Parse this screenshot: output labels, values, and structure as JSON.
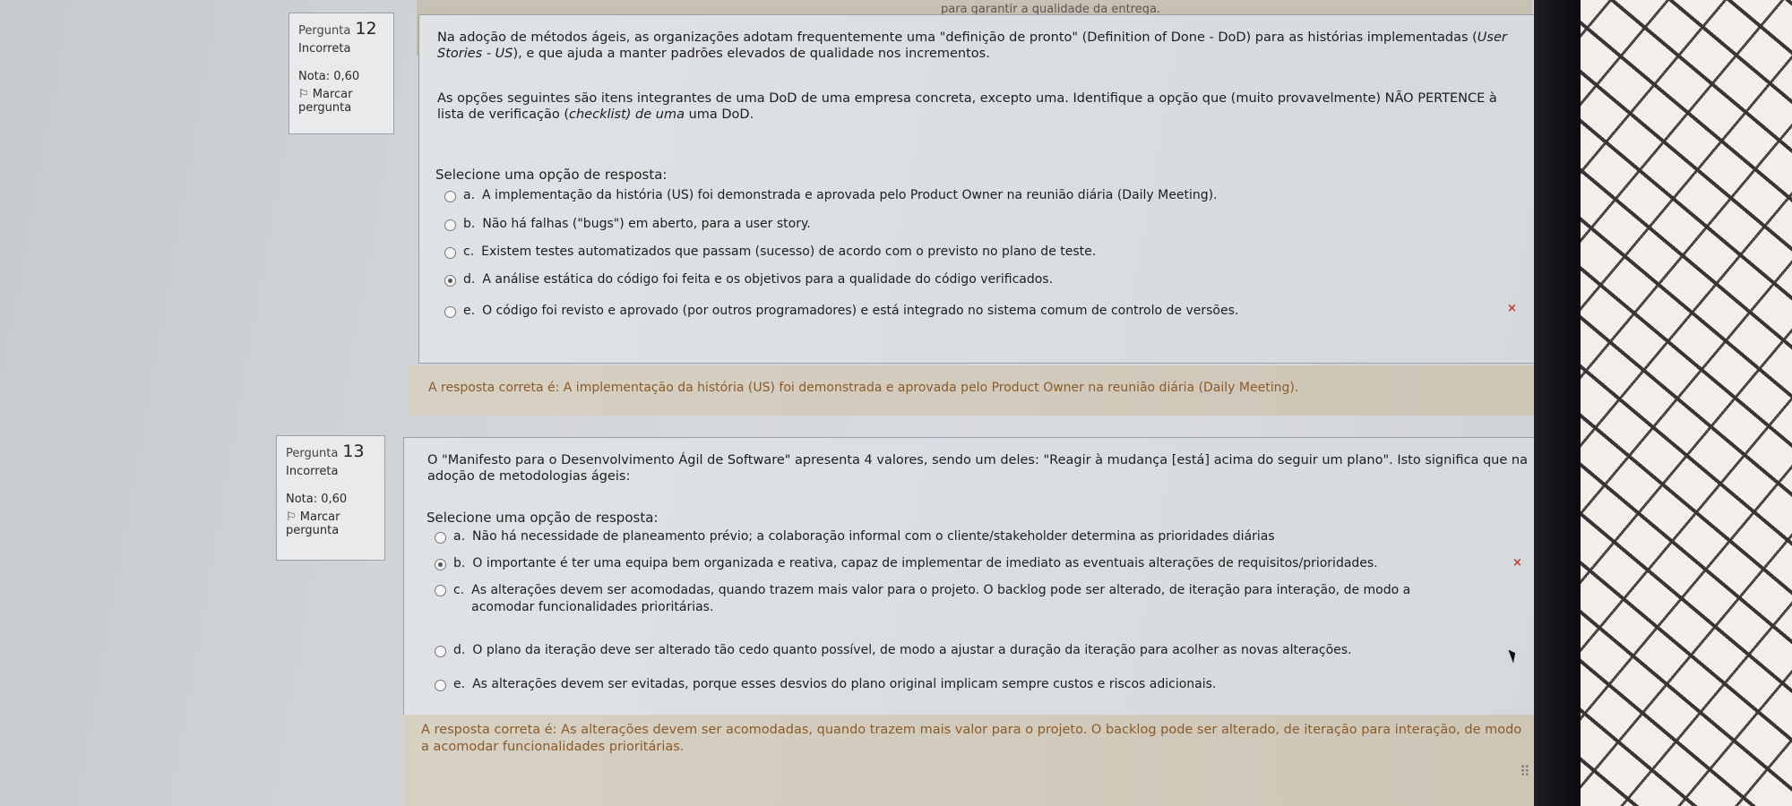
{
  "top_strip_text": "para garantir a qualidade da entrega.",
  "q12": {
    "label": "Pergunta",
    "number": "12",
    "status": "Incorreta",
    "grade": "Nota: 0,60",
    "flag_label": "Marcar pergunta",
    "text_1": "Na adoção de métodos ágeis, as organizações adotam frequentemente uma \"definição de pronto\" (Definition of Done - DoD) para as histórias implementadas (",
    "text_1_italic": "User Stories - US",
    "text_1_end": "), e que ajuda a manter padrões elevados de qualidade nos incrementos.",
    "text_2": "As opções seguintes são itens integrantes de uma DoD de uma empresa concreta, excepto uma. Identifique a opção que (muito provavelmente) NÃO PERTENCE à lista de verificação (",
    "text_2_italic": "checklist) de uma",
    "text_2_end": " uma DoD.",
    "prompt": "Selecione uma opção de resposta:",
    "options": [
      {
        "letter": "a.",
        "text": "A implementação da história (US) foi demonstrada e aprovada pelo Product Owner na reunião diária (Daily Meeting).",
        "checked": false
      },
      {
        "letter": "b.",
        "text": "Não há falhas (\"bugs\") em aberto, para a user story.",
        "checked": false
      },
      {
        "letter": "c.",
        "text": "Existem testes automatizados que passam (sucesso) de acordo com o previsto no plano de teste.",
        "checked": false
      },
      {
        "letter": "d.",
        "text": "A análise estática do código foi feita e os objetivos para a qualidade do código verificados.",
        "checked": true
      },
      {
        "letter": "e.",
        "text": "O código foi revisto e aprovado (por outros programadores) e está integrado no sistema comum de controlo de versões.",
        "checked": false
      }
    ],
    "wrong_mark": "×",
    "feedback": "A resposta correta é: A implementação da história (US) foi demonstrada e aprovada pelo Product Owner na reunião diária (Daily Meeting)."
  },
  "q13": {
    "label": "Pergunta",
    "number": "13",
    "status": "Incorreta",
    "grade": "Nota: 0,60",
    "flag_label": "Marcar pergunta",
    "text_1": "O \"Manifesto para o Desenvolvimento Ágil de Software\" apresenta 4 valores, sendo um deles: \"Reagir à mudança [está] acima do seguir um plano\". Isto significa que na adoção de metodologias ágeis:",
    "prompt": "Selecione uma opção de resposta:",
    "options": [
      {
        "letter": "a.",
        "text": "Não há necessidade de planeamento prévio;  a colaboração informal com o cliente/stakeholder determina as prioridades diárias",
        "checked": false
      },
      {
        "letter": "b.",
        "text": "O importante é ter uma equipa bem organizada e reativa, capaz de implementar de imediato as eventuais alterações de requisitos/prioridades.",
        "checked": true
      },
      {
        "letter": "c.",
        "text": "As alterações devem ser acomodadas, quando trazem mais valor para o projeto.  O backlog pode ser alterado, de iteração para interação, de modo a acomodar funcionalidades prioritárias.",
        "checked": false
      },
      {
        "letter": "d.",
        "text": "O plano da iteração deve ser alterado tão cedo quanto possível, de modo a ajustar a duração da iteração para acolher as novas alterações.",
        "checked": false
      },
      {
        "letter": "e.",
        "text": "As alterações devem ser evitadas, porque esses desvios do plano original implicam sempre custos e riscos adicionais.",
        "checked": false
      }
    ],
    "wrong_mark": "×",
    "feedback": "A resposta correta é: As alterações devem ser acomodadas, quando trazem mais valor para o projeto.  O backlog pode ser alterado, de iteração para interação, de modo a acomodar funcionalidades prioritárias."
  }
}
